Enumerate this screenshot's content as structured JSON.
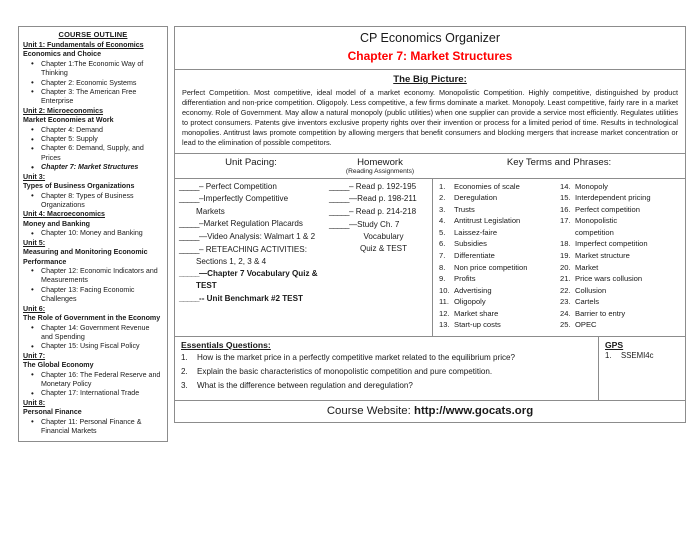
{
  "outline": {
    "title": "COURSE OUTLINE",
    "units": [
      {
        "unit": "Unit 1: Fundamentals of Economics",
        "subhead": "Economics and Choice",
        "chapters": [
          "Chapter 1:The Economic Way of Thinking",
          "Chapter 2: Economic Systems",
          "Chapter 3: The American Free Enterprise"
        ]
      },
      {
        "unit": "Unit 2:  Microeconomics",
        "subhead": "Market Economies at Work",
        "chapters": [
          "Chapter 4: Demand",
          "Chapter 5: Supply",
          "Chapter 6: Demand, Supply, and Prices"
        ],
        "highlight": "Chapter 7: Market Structures"
      },
      {
        "unit": "Unit 3:",
        "subhead": "Types of Business Organizations",
        "chapters": [
          "Chapter 8:  Types of Business Organizations"
        ]
      },
      {
        "unit": "Unit 4:  Macroeconomics",
        "subhead": "Money and Banking",
        "chapters": [
          "Chapter 10:  Money and Banking"
        ]
      },
      {
        "unit": "Unit 5:",
        "subhead": "Measuring and Monitoring Economic Performance",
        "chapters": [
          "Chapter 12:  Economic Indicators and Measurements",
          "Chapter 13:  Facing Economic Challenges"
        ]
      },
      {
        "unit": "Unit 6:",
        "subhead": "The Role of Government in the Economy",
        "chapters": [
          "Chapter 14:  Government Revenue and Spending",
          "Chapter 15:  Using Fiscal Policy"
        ]
      },
      {
        "unit": "Unit 7:",
        "subhead": "The Global Economy",
        "chapters": [
          "Chapter 16: The Federal Reserve and Monetary Policy",
          "Chapter 17: International Trade"
        ]
      },
      {
        "unit": "Unit 8:",
        "subhead": "Personal Finance",
        "chapters": [
          "Chapter 11: Personal Finance & Financial Markets"
        ]
      }
    ]
  },
  "header": {
    "title": "CP Economics Organizer",
    "subtitle": "Chapter 7: Market Structures",
    "subtitle_color": "#ff0000"
  },
  "big_picture": {
    "heading": "The Big Picture:",
    "body": "Perfect Competition. Most competitive, ideal model of a market economy.  Monopolistic Competition.  Highly competitive, distinguished by product differentiation and non-price competition.  Oligopoly.  Less competitive, a few firms dominate a market.   Monopoly. Least competitive, fairly rare in a market economy.  Role of Government.  May allow a natural monopoly (public utilities) when one supplier can provide a service most efficiently.  Regulates utilities to protect consumers.  Patents give inventors exclusive property rights over their invention or process for a limited period of time.  Results in technological monopolies.  Antitrust laws promote competition by allowing mergers that benefit consumers and blocking mergers that increase market concentration or lead to the elimination of possible competitors."
  },
  "unit_pacing": {
    "heading": "Unit Pacing:",
    "items": [
      {
        "blank": "_____",
        "dash": "– ",
        "text": "Perfect Competition",
        "bold": false
      },
      {
        "blank": "_____",
        "dash": "–",
        "text": "Imperfectly Competitive",
        "cont": "Markets",
        "bold": false
      },
      {
        "blank": "_____",
        "dash": "–",
        "text": "Market Regulation Placards",
        "bold": false
      },
      {
        "blank": "_____",
        "dash": "—",
        "text": "Video Analysis: Walmart 1 & 2",
        "bold": false
      },
      {
        "blank": "_____",
        "dash": "– ",
        "text": "RETEACHING ACTIVITIES:",
        "cont": "Sections 1, 2, 3 & 4",
        "bold": false
      },
      {
        "blank": "_____",
        "dash": "—",
        "text": "Chapter 7 Vocabulary Quiz &",
        "cont": "TEST",
        "bold": true
      },
      {
        "blank": "_____",
        "dash": "-- ",
        "text": "Unit Benchmark #2 TEST",
        "bold": true
      }
    ]
  },
  "homework": {
    "heading": "Homework",
    "subheading": "(Reading Assignments)",
    "items": [
      {
        "blank": "_____",
        "dash": "– ",
        "text": "Read p. 192-195"
      },
      {
        "blank": "_____",
        "dash": "—",
        "text": "Read p. 198-211"
      },
      {
        "blank": "_____",
        "dash": "– ",
        "text": "Read p. 214-218"
      },
      {
        "blank": "_____",
        "dash": "—",
        "text": "Study Ch. 7",
        "cont": "Vocabulary",
        "cont2": "Quiz & TEST"
      }
    ]
  },
  "key_terms": {
    "heading": "Key Terms and Phrases:",
    "left": [
      {
        "num": "1.",
        "text": "Economies of scale"
      },
      {
        "num": "2.",
        "text": "Deregulation"
      },
      {
        "num": "3.",
        "text": "Trusts"
      },
      {
        "num": "4.",
        "text": "Antitrust Legislation"
      },
      {
        "num": "5.",
        "text": "Laissez-faire"
      },
      {
        "num": "6.",
        "text": "Subsidies"
      },
      {
        "num": "7.",
        "text": "Differentiate"
      },
      {
        "num": "8.",
        "text": "Non price competition"
      },
      {
        "num": "9.",
        "text": "Profits"
      },
      {
        "num": "10.",
        "text": "Advertising"
      },
      {
        "num": "11.",
        "text": "Oligopoly"
      },
      {
        "num": "12.",
        "text": "Market share"
      },
      {
        "num": "13.",
        "text": "Start-up costs"
      }
    ],
    "right": [
      {
        "num": "14.",
        "text": "Monopoly"
      },
      {
        "num": "15.",
        "text": "Interdependent pricing"
      },
      {
        "num": "16.",
        "text": "Perfect competition"
      },
      {
        "num": "17.",
        "text": "Monopolistic",
        "cont": "competition"
      },
      {
        "num": "18.",
        "text": "Imperfect competition"
      },
      {
        "num": "19.",
        "text": "Market structure"
      },
      {
        "num": "20.",
        "text": "Market"
      },
      {
        "num": "21.",
        "text": "Price wars collusion"
      },
      {
        "num": "22.",
        "text": "Collusion"
      },
      {
        "num": "23.",
        "text": "Cartels"
      },
      {
        "num": "24.",
        "text": "Barrier to entry"
      },
      {
        "num": "25.",
        "text": "OPEC"
      }
    ]
  },
  "essentials": {
    "heading": "Essentials Questions:",
    "questions": [
      {
        "num": "1.",
        "text": "How is the market price in a perfectly competitive market related to the equilibrium price?"
      },
      {
        "num": "2.",
        "text": "Explain the basic characteristics of monopolistic competition and pure competition."
      },
      {
        "num": "3.",
        "text": "What is the difference between regulation and deregulation?"
      }
    ]
  },
  "gps": {
    "heading": "GPS",
    "items": [
      {
        "num": "1.",
        "text": "SSEMI4c"
      }
    ]
  },
  "footer": {
    "label": "Course Website:",
    "url": "http://www.gocats.org"
  }
}
